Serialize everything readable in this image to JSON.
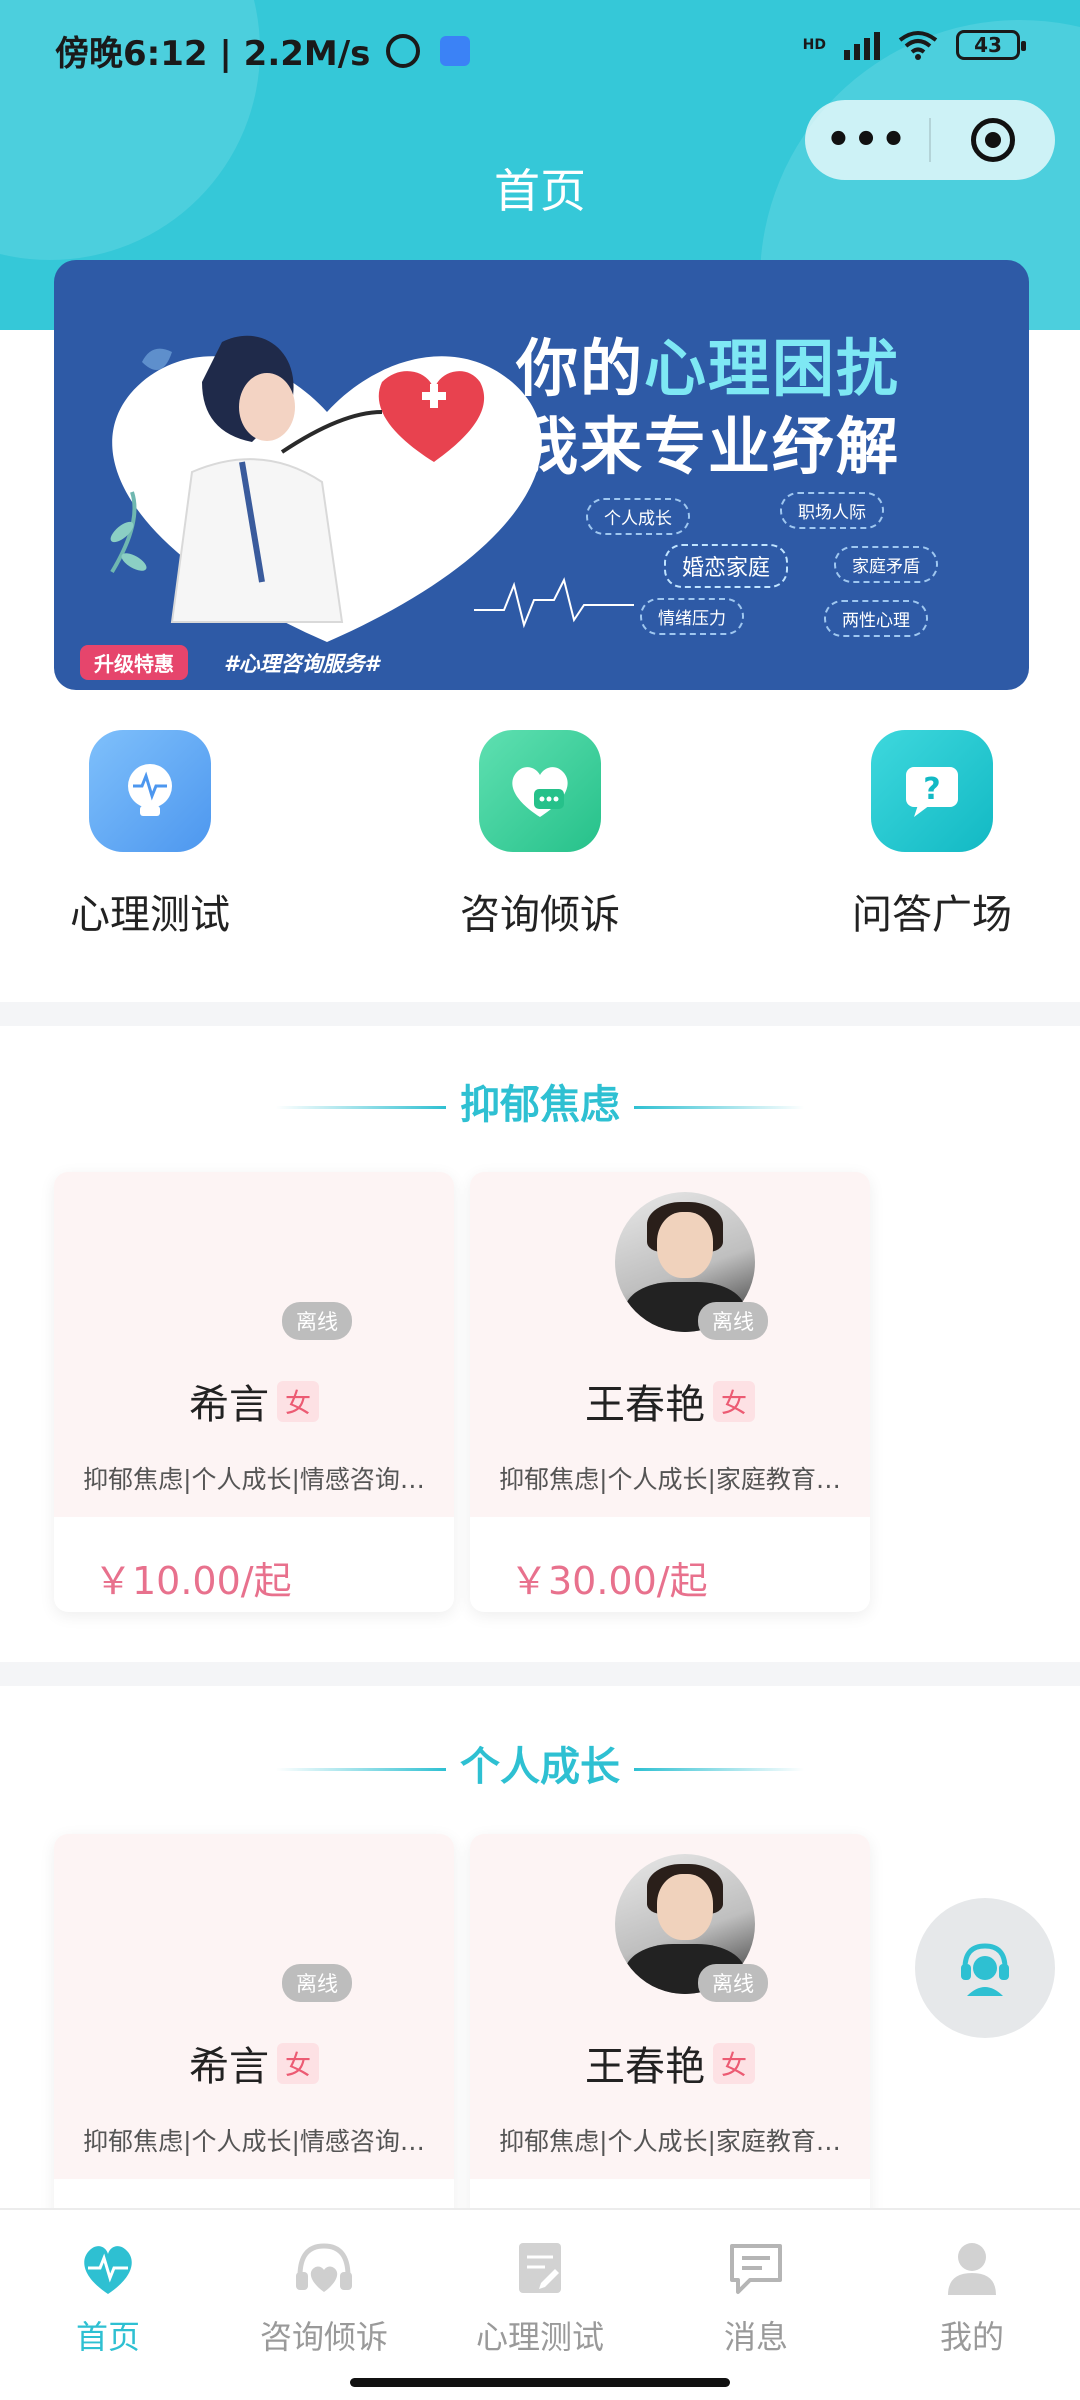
{
  "status_bar": {
    "time_speed": "傍晚6:12 | 2.2M/s",
    "network": "HD",
    "battery": "43"
  },
  "header": {
    "title": "首页"
  },
  "banner": {
    "headline_1a": "你的",
    "headline_1b": "心理困扰",
    "headline_2": "我来专业纾解",
    "tags": [
      "个人成长",
      "职场人际",
      "婚恋家庭",
      "家庭矛盾",
      "情绪压力",
      "两性心理"
    ],
    "promo_badge": "升级特惠",
    "promo_text": "#心理咨询服务#"
  },
  "quick_actions": [
    {
      "label": "心理测试",
      "icon": "lightbulb-pulse-icon",
      "color": "#5aa7f5"
    },
    {
      "label": "咨询倾诉",
      "icon": "heart-chat-icon",
      "color": "#34d19a"
    },
    {
      "label": "问答广场",
      "icon": "question-bubble-icon",
      "color": "#22c7cf"
    }
  ],
  "sections": [
    {
      "title": "抑郁焦虑",
      "counselors": [
        {
          "name": "希言",
          "gender": "女",
          "status": "离线",
          "tags": "抑郁焦虑|个人成长|情感咨询…",
          "price": "￥10.00/起"
        },
        {
          "name": "王春艳",
          "gender": "女",
          "status": "离线",
          "tags": "抑郁焦虑|个人成长|家庭教育…",
          "price": "￥30.00/起"
        }
      ]
    },
    {
      "title": "个人成长",
      "counselors": [
        {
          "name": "希言",
          "gender": "女",
          "status": "离线",
          "tags": "抑郁焦虑|个人成长|情感咨询…"
        },
        {
          "name": "王春艳",
          "gender": "女",
          "status": "离线",
          "tags": "抑郁焦虑|个人成长|家庭教育…"
        }
      ]
    }
  ],
  "tabbar": [
    {
      "label": "首页",
      "icon": "heart-pulse-icon",
      "active": true
    },
    {
      "label": "咨询倾诉",
      "icon": "headset-heart-icon",
      "active": false
    },
    {
      "label": "心理测试",
      "icon": "clipboard-icon",
      "active": false
    },
    {
      "label": "消息",
      "icon": "message-icon",
      "active": false
    },
    {
      "label": "我的",
      "icon": "user-icon",
      "active": false
    }
  ],
  "colors": {
    "accent": "#2ec0d2",
    "header_bg": "#35c8d8",
    "price": "#e8718d",
    "banner_bg": "#2e5aa6"
  }
}
